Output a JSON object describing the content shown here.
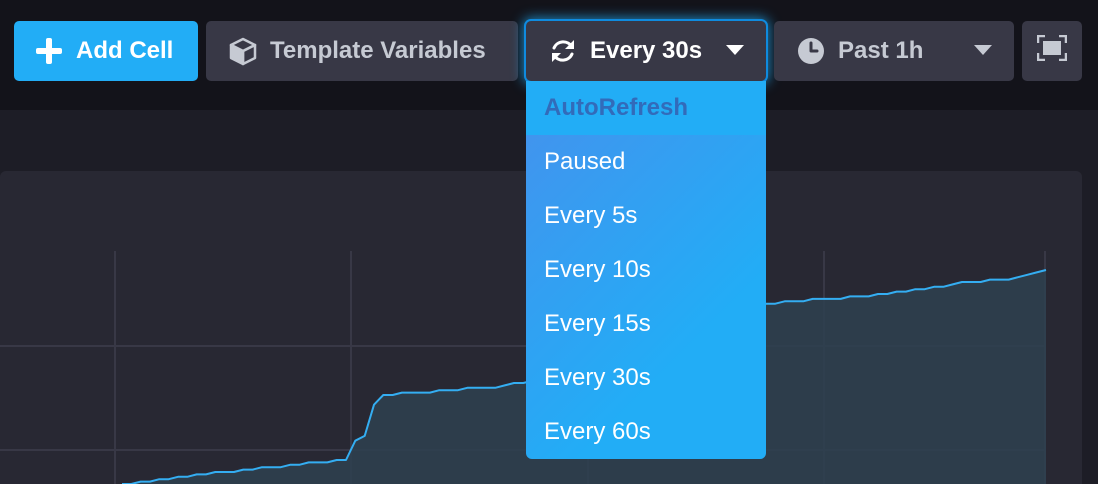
{
  "toolbar": {
    "add_cell_label": "Add Cell",
    "template_variables_label": "Template Variables",
    "autorefresh_selected": "Every 30s",
    "time_range_selected": "Past 1h"
  },
  "autorefresh_menu": {
    "header": "AutoRefresh",
    "options": [
      "Paused",
      "Every 5s",
      "Every 10s",
      "Every 15s",
      "Every 30s",
      "Every 60s"
    ]
  },
  "icons": {
    "add": "plus-icon",
    "template": "cube-icon",
    "refresh": "refresh-icon",
    "time": "clock-icon",
    "caret": "caret-down-icon",
    "present": "fullscreen-icon"
  },
  "colors": {
    "primary": "#22adf6",
    "series_line": "#34aef2",
    "series_fill": "#2e4150",
    "toolbar_bg": "#13131a",
    "cell_bg": "#282833",
    "button_bg": "#383846"
  },
  "chart_data": {
    "type": "area",
    "grid": true,
    "series": [
      {
        "values": [
          0.0,
          0.0,
          0.01,
          0.01,
          0.02,
          0.02,
          0.03,
          0.03,
          0.04,
          0.04,
          0.05,
          0.05,
          0.05,
          0.06,
          0.06,
          0.07,
          0.07,
          0.07,
          0.08,
          0.08,
          0.09,
          0.09,
          0.09,
          0.1,
          0.1,
          0.18,
          0.2,
          0.33,
          0.37,
          0.37,
          0.38,
          0.38,
          0.38,
          0.38,
          0.39,
          0.39,
          0.39,
          0.4,
          0.4,
          0.4,
          0.4,
          0.41,
          0.42,
          0.42,
          0.43,
          0.5,
          0.52,
          0.56,
          0.58,
          0.58,
          0.6,
          0.61,
          0.62,
          0.63,
          0.64,
          0.65,
          0.66,
          0.67,
          0.68,
          0.69,
          0.7,
          0.71,
          0.72,
          0.72,
          0.73,
          0.73,
          0.74,
          0.74,
          0.74,
          0.75,
          0.75,
          0.76,
          0.76,
          0.76,
          0.77,
          0.77,
          0.77,
          0.77,
          0.78,
          0.78,
          0.78,
          0.79,
          0.79,
          0.8,
          0.8,
          0.81,
          0.81,
          0.82,
          0.82,
          0.83,
          0.84,
          0.84,
          0.84,
          0.85,
          0.85,
          0.85,
          0.86,
          0.87,
          0.88,
          0.89
        ]
      }
    ]
  }
}
